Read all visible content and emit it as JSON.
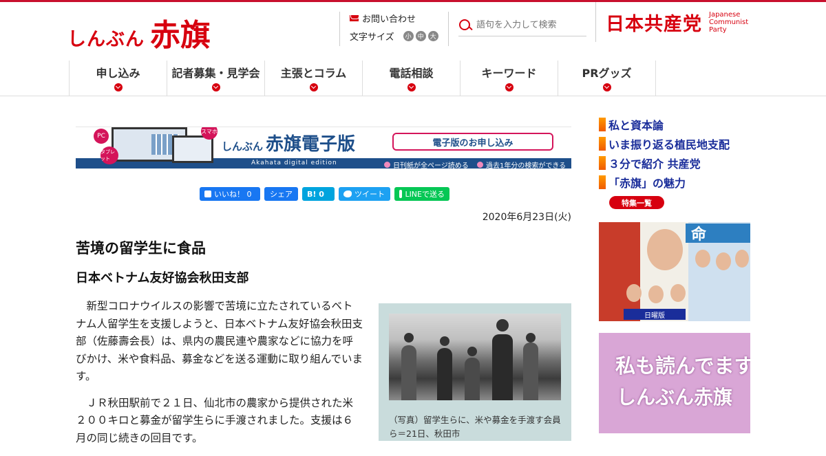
{
  "site": {
    "logo_small": "しんぶん",
    "logo_big": "赤旗"
  },
  "util": {
    "contact_label": "お問い合わせ",
    "fontsize_label": "文字サイズ",
    "fontsize_options": [
      "小",
      "中",
      "大"
    ]
  },
  "search": {
    "placeholder": "語句を入力して検索"
  },
  "party": {
    "name_jp": "日本共産党",
    "name_en_1": "Japanese",
    "name_en_2": "Communist",
    "name_en_3": "Party"
  },
  "nav": [
    {
      "label": "申し込み"
    },
    {
      "label": "記者募集・見学会"
    },
    {
      "label": "主張とコラム"
    },
    {
      "label": "電話相談"
    },
    {
      "label": "キーワード"
    },
    {
      "label": "PRグッズ"
    }
  ],
  "banner": {
    "pc": "PC",
    "smartphone": "スマホ",
    "tablet": "タブレット",
    "title_small": "しんぶん",
    "title_big": "赤旗電子版",
    "edition": "Akahata digital edition",
    "apply": "電子版のお申し込み",
    "feature_1": "日刊紙が全ページ読める",
    "feature_2": "過去1年分の検索ができる"
  },
  "social": {
    "like": "いいね！ 0",
    "share": "シェア",
    "hatena": "B! 0",
    "tweet": "ツイート",
    "line": "LINEで送る"
  },
  "article": {
    "date": "2020年6月23日(火)",
    "title": "苦境の留学生に食品",
    "subtitle": "日本ベトナム友好協会秋田支部",
    "paragraphs": [
      "新型コロナウイルスの影響で苦境に立たされているベトナム人留学生を支援しようと、日本ベトナム友好協会秋田支部（佐藤壽会長）は、県内の農民連や農家などに協力を呼びかけ、米や食料品、募金などを送る運動に取り組んでいます。",
      "ＪＲ秋田駅前で２１日、仙北市の農家から提供された米２００キロと募金が留学生らに手渡されました。支援は６月の同じ続きの回目です。"
    ],
    "photo_caption": "（写真）留学生らに、米や募金を手渡す会員ら＝21日、秋田市"
  },
  "sidebar": {
    "features": [
      {
        "label": "私と資本論"
      },
      {
        "label": "いま振り返る植民地支配"
      },
      {
        "label": "３分で紹介 共産党"
      },
      {
        "label": "「赤旗」の魅力"
      }
    ],
    "all_button": "特集一覧",
    "ad1_mark": "命",
    "ad1_day": "日曜版",
    "ad2_line1": "私も読んでます",
    "ad2_line2": "しんぶん赤旗"
  },
  "colors": {
    "brand_red": "#d7000f",
    "link_blue": "#1a2d9a",
    "banner_blue": "#1e4f8a"
  }
}
